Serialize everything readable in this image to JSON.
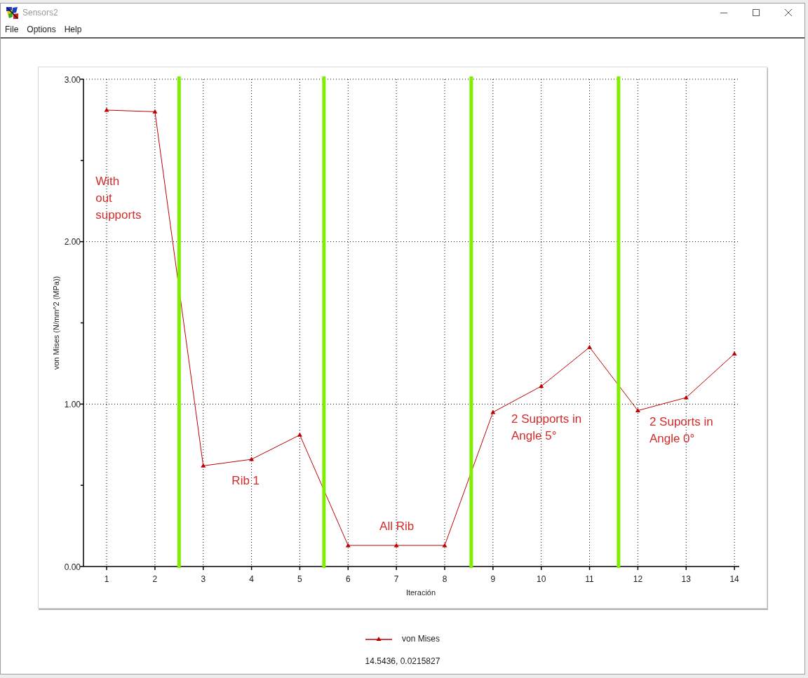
{
  "window": {
    "title": "Sensors2"
  },
  "menu": [
    "File",
    "Options",
    "Help"
  ],
  "chart": {
    "chart_data": {
      "type": "line",
      "xlabel": "Iteración",
      "ylabel": "von Mises (N/mm^2 (MPa))",
      "x": [
        1,
        2,
        3,
        4,
        5,
        6,
        7,
        8,
        9,
        10,
        11,
        12,
        13,
        14
      ],
      "series": [
        {
          "name": "von Mises",
          "color": "#c00000",
          "marker": "triangle",
          "values": [
            2.81,
            2.8,
            0.62,
            0.66,
            0.81,
            0.13,
            0.13,
            0.13,
            0.95,
            1.11,
            1.35,
            0.96,
            1.04,
            1.31
          ]
        }
      ],
      "xlim": [
        0.52,
        14.1
      ],
      "ylim": [
        0,
        3
      ],
      "xticks": [
        1,
        2,
        3,
        4,
        5,
        6,
        7,
        8,
        9,
        10,
        11,
        12,
        13,
        14
      ],
      "yticks": [
        {
          "value": 0,
          "label": "0.00"
        },
        {
          "value": 1,
          "label": "1.00"
        },
        {
          "value": 2,
          "label": "2.00"
        },
        {
          "value": 3,
          "label": "3.00"
        }
      ],
      "grid": true,
      "ref_lines": [
        {
          "axis": "x",
          "value": 2.5,
          "color": "#80ee00"
        },
        {
          "axis": "x",
          "value": 5.5,
          "color": "#80ee00"
        },
        {
          "axis": "x",
          "value": 8.55,
          "color": "#80ee00"
        },
        {
          "axis": "x",
          "value": 11.6,
          "color": "#80ee00"
        }
      ],
      "annotations": [
        "With\nout\nsupports",
        "Rib 1",
        "All Rib",
        "2 Supports in\nAngle 5°",
        "2 Suports in\nAngle 0°"
      ]
    }
  },
  "readout": "14.5436, 0.0215827"
}
